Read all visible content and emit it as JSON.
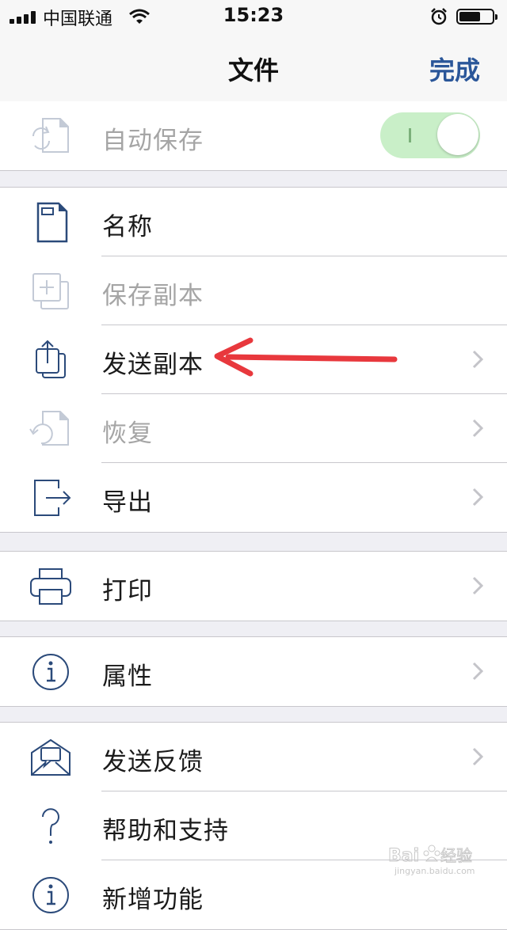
{
  "status_bar": {
    "carrier": "中国联通",
    "time": "15:23"
  },
  "nav": {
    "title": "文件",
    "done_label": "完成"
  },
  "autosave": {
    "label": "自动保存",
    "toggle_on": true,
    "enabled": false
  },
  "groups": [
    [
      {
        "label": "名称",
        "icon": "document-icon",
        "disabled": false,
        "chevron": false
      },
      {
        "label": "保存副本",
        "icon": "duplicate-icon",
        "disabled": true,
        "chevron": false
      },
      {
        "label": "发送副本",
        "icon": "share-icon",
        "disabled": false,
        "chevron": true
      },
      {
        "label": "恢复",
        "icon": "restore-icon",
        "disabled": true,
        "chevron": true
      },
      {
        "label": "导出",
        "icon": "export-icon",
        "disabled": false,
        "chevron": true
      }
    ],
    [
      {
        "label": "打印",
        "icon": "printer-icon",
        "disabled": false,
        "chevron": true
      }
    ],
    [
      {
        "label": "属性",
        "icon": "info-icon",
        "disabled": false,
        "chevron": true
      }
    ],
    [
      {
        "label": "发送反馈",
        "icon": "feedback-mail-icon",
        "disabled": false,
        "chevron": true
      },
      {
        "label": "帮助和支持",
        "icon": "help-icon",
        "disabled": false,
        "chevron": false
      },
      {
        "label": "新增功能",
        "icon": "info-icon",
        "disabled": false,
        "chevron": false
      }
    ]
  ],
  "colors": {
    "accent": "#2a5699",
    "toggle_track": "#c9efc8",
    "annotation_arrow": "#e8383d"
  },
  "watermark": {
    "brand": "Baidu经验",
    "url": "jingyan.baidu.com"
  }
}
